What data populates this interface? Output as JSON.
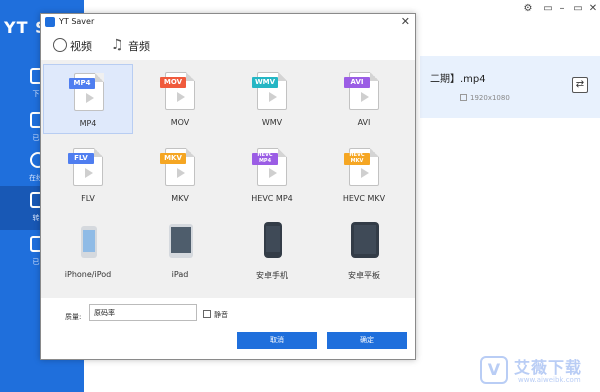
{
  "app": {
    "title": "YT S",
    "sidebar": [
      {
        "label": "下"
      },
      {
        "label": "已"
      },
      {
        "label": "在线"
      },
      {
        "label": "转"
      },
      {
        "label": "已"
      }
    ],
    "file": {
      "name": "二期】.mp4",
      "resolution": "1920x1080"
    },
    "window_controls": {
      "settings": "⚙",
      "minimize": "▭",
      "maximize": "▭",
      "close": "✕"
    }
  },
  "dialog": {
    "title": "YT Saver",
    "close": "✕",
    "tabs": [
      {
        "label": "视频"
      },
      {
        "label": "音频"
      }
    ],
    "formats": [
      {
        "badge": "MP4",
        "label": "MP4",
        "color": "#4f7ef0"
      },
      {
        "badge": "MOV",
        "label": "MOV",
        "color": "#f05a3c"
      },
      {
        "badge": "WMV",
        "label": "WMV",
        "color": "#24b6c4"
      },
      {
        "badge": "AVI",
        "label": "AVI",
        "color": "#9b5de5"
      },
      {
        "badge": "FLV",
        "label": "FLV",
        "color": "#4f7ef0"
      },
      {
        "badge": "MKV",
        "label": "MKV",
        "color": "#f5a623"
      },
      {
        "badge": "HEVC MP4",
        "label": "HEVC MP4",
        "color": "#9b5de5"
      },
      {
        "badge": "HEVC MKV",
        "label": "HEVC MKV",
        "color": "#f5a623"
      }
    ],
    "devices": [
      {
        "label": "iPhone/iPod"
      },
      {
        "label": "iPad"
      },
      {
        "label": "安卓手机"
      },
      {
        "label": "安卓平板"
      }
    ],
    "quality_label": "质量:",
    "quality_value": "原码率",
    "mute_label": "静音",
    "cancel_label": "取消",
    "ok_label": "确定"
  },
  "watermark": {
    "logo": "V",
    "text": "艾薇下载",
    "url": "www.aiweibk.com"
  }
}
